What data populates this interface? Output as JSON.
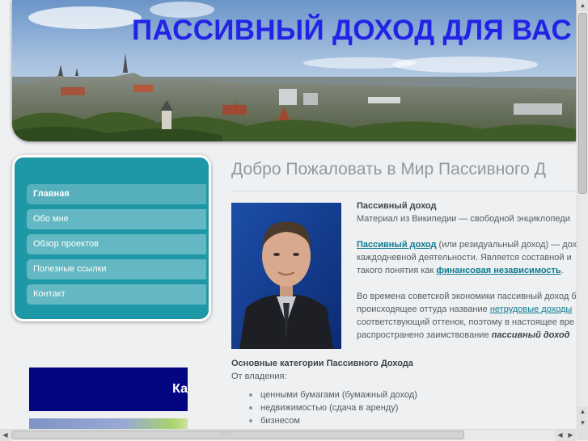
{
  "header": {
    "site_title": "ПАССИВНЫЙ ДОХОД ДЛЯ ВАС",
    "image": "tallinn-panorama-image"
  },
  "nav": {
    "items": [
      {
        "label": "Главная",
        "active": true
      },
      {
        "label": "Обо мне"
      },
      {
        "label": "Обзор проектов"
      },
      {
        "label": "Полезные ссылки"
      },
      {
        "label": "Контакт"
      }
    ]
  },
  "sidebar": {
    "banner1_text": "Ка"
  },
  "main": {
    "page_title": "Добро Пожаловать в Мир Пассивного Д",
    "intro_title": "Пассивный доход",
    "intro_source": "Материал из Википедии — свободной энциклопеди",
    "p1": {
      "link": "Пассивный доход",
      "text1": " (или резидуальный доход) — дох",
      "line2": "каждодневной деятельности. Является составной и",
      "line3_pre": "такого понятия как ",
      "link2": "финансовая независимость",
      "line3_post": "."
    },
    "p2": {
      "line1": "Во времена советской экономики пассивный доход б",
      "line2_pre": "происходящее оттуда название ",
      "link": "нетрудовые доходы",
      "line3": "соответствующий оттенок, поэтому в настоящее вре",
      "line4_pre": "распространено заимствование ",
      "line4_em": "пассивный доход"
    },
    "categories_title": "Основные категории Пассивного Дохода",
    "ownership_label": "От владения:",
    "bullets": [
      "ценными бумагами (бумажный доход)",
      "недвижимостью (сдача в аренду)",
      "бизнесом"
    ]
  },
  "colors": {
    "title": "#2323e6",
    "nav_bg": "#1e97a6",
    "nav_item": "#63b8c3",
    "link": "#0f7c90",
    "page_bg": "#eef0f2"
  }
}
